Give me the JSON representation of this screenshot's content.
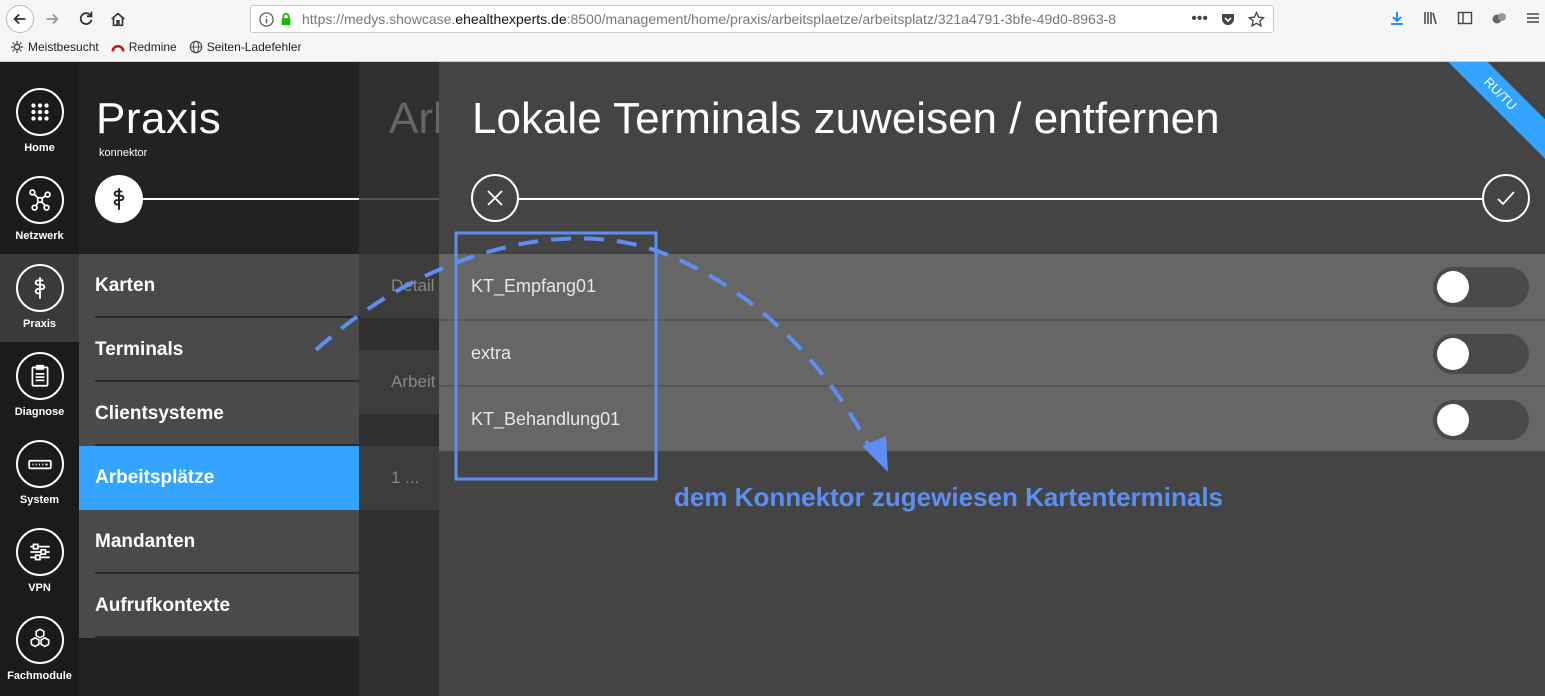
{
  "browser": {
    "url_prefix": "https://medys.showcase.",
    "url_host": "ehealthexperts.de",
    "url_rest": ":8500/management/home/praxis/arbeitsplaetze/arbeitsplatz/321a4791-3bfe-49d0-8963-8",
    "bookmarks": [
      {
        "label": "Meistbesucht",
        "icon": "gear-icon"
      },
      {
        "label": "Redmine",
        "icon": "redmine-icon"
      },
      {
        "label": "Seiten-Ladefehler",
        "icon": "globe-icon"
      }
    ]
  },
  "iconbar": [
    {
      "label": "Home",
      "icon": "grid-icon"
    },
    {
      "label": "Netzwerk",
      "icon": "network-icon"
    },
    {
      "label": "Praxis",
      "icon": "caduceus-icon",
      "active": true
    },
    {
      "label": "Diagnose",
      "icon": "clipboard-icon"
    },
    {
      "label": "System",
      "icon": "server-icon"
    },
    {
      "label": "VPN",
      "icon": "sliders-icon"
    },
    {
      "label": "Fachmodule",
      "icon": "hexagons-icon"
    }
  ],
  "praxis": {
    "title": "Praxis",
    "subtitle": "konnektor",
    "menu": [
      {
        "label": "Karten"
      },
      {
        "label": "Terminals"
      },
      {
        "label": "Clientsysteme"
      },
      {
        "label": "Arbeitsplätze",
        "active": true
      },
      {
        "label": "Mandanten"
      },
      {
        "label": "Aufrufkontexte"
      }
    ]
  },
  "middle": {
    "title": "Arb",
    "rows": [
      "Detail",
      "Arbeit",
      "1 ..."
    ]
  },
  "overlay": {
    "title": "Lokale Terminals zuweisen / entfernen",
    "ribbon": "RU/TU",
    "terminals": [
      {
        "name": "KT_Empfang01",
        "enabled": false
      },
      {
        "name": "extra",
        "enabled": false
      },
      {
        "name": "KT_Behandlung01",
        "enabled": false
      }
    ]
  },
  "annotation": {
    "label": "dem Konnektor zugewiesen Kartenterminals",
    "color": "#5b8ff2"
  }
}
